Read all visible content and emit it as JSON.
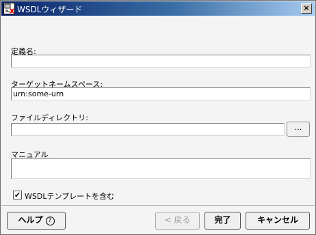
{
  "window": {
    "title": "WSDLウィザード",
    "close_glyph": "×"
  },
  "form": {
    "definition_name": {
      "label": "定義名:",
      "value": ""
    },
    "target_namespace": {
      "label": "ターゲットネームスペース:",
      "value": "urn:some-urn"
    },
    "file_directory": {
      "label": "ファイルディレクトリ:",
      "value": "",
      "browse_label": "..."
    },
    "manual": {
      "label": "マニュアル",
      "value": ""
    },
    "wsdl_template": {
      "label": "WSDLテンプレートを含む",
      "checked": true,
      "check_glyph": "✔"
    }
  },
  "buttons": {
    "help": "ヘルプ",
    "help_icon_glyph": "?",
    "back": "< 戻る",
    "finish": "完了",
    "cancel": "キャンセル"
  },
  "colors": {
    "title_gradient_start": "#0a246a",
    "title_gradient_end": "#a6caf0",
    "dialog_background": "#f4f4f4"
  },
  "icons": {
    "app": "wsdl-app-icon",
    "close": "close-icon",
    "check": "checkmark-icon",
    "help": "question-circle-icon"
  }
}
